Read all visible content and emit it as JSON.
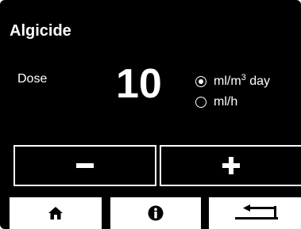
{
  "header": {
    "title": "Algicide"
  },
  "dose": {
    "label": "Dose",
    "value": "10",
    "units": [
      {
        "base": "ml/m",
        "sup": "3",
        "rest": " day",
        "selected": true
      },
      {
        "base": "ml/h",
        "sup": "",
        "rest": "",
        "selected": false
      }
    ]
  },
  "controls": {
    "decrement_icon": "minus-icon",
    "increment_icon": "plus-icon"
  },
  "nav": {
    "home_icon": "home-icon",
    "info_icon": "info-icon",
    "back_icon": "return-arrow-icon"
  },
  "colors": {
    "background": "#000000",
    "foreground": "#ffffff"
  }
}
